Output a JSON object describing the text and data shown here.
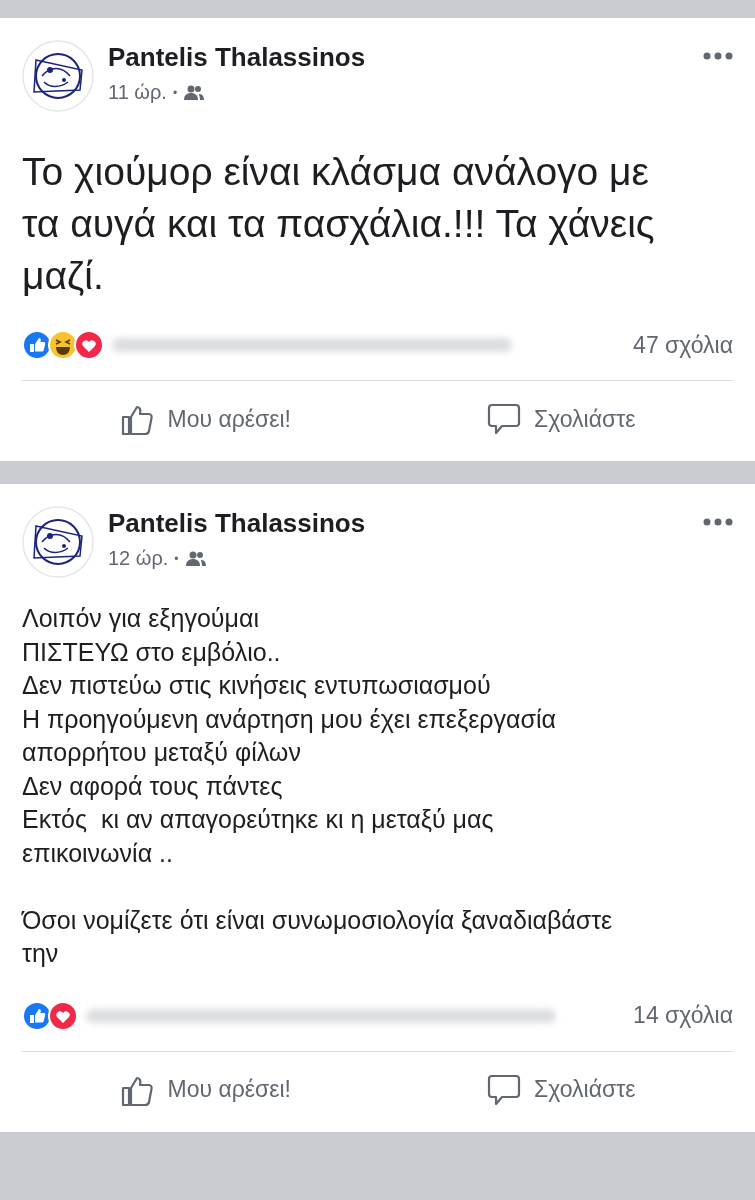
{
  "posts": [
    {
      "author": "Pantelis Thalassinos",
      "time": "11 ώρ.",
      "dot": "•",
      "kind": "large",
      "text": "Το χιούμορ είναι κλάσμα ανάλογο με\nτα αυγά και τα πασχάλια.!!! Τα χάνεις\nμαζί.",
      "reactions": [
        {
          "kind": "like"
        },
        {
          "kind": "haha"
        },
        {
          "kind": "love"
        }
      ],
      "comments": "47 σχόλια",
      "like_label": "Μου αρέσει!",
      "comment_label": "Σχολιάστε"
    },
    {
      "author": "Pantelis Thalassinos",
      "time": "12 ώρ.",
      "dot": "•",
      "kind": "normal",
      "text": "Λοιπόν για εξηγούμαι\nΠΙΣΤΕΥΩ στο εμβόλιο..\nΔεν πιστεύω στις κινήσεις εντυπωσιασμού\nΗ προηγούμενη ανάρτηση μου έχει επεξεργασία\nαπορρήτου μεταξύ φίλων\nΔεν αφορά τους πάντες\nΕκτός  κι αν απαγορεύτηκε κι η μεταξύ μας\nεπικοινωνία ..\n\nΌσοι νομίζετε ότι είναι συνωμοσιολογία ξαναδιαβάστε\nτην",
      "reactions": [
        {
          "kind": "like"
        },
        {
          "kind": "love"
        }
      ],
      "comments": "14 σχόλια",
      "like_label": "Μου αρέσει!",
      "comment_label": "Σχολιάστε"
    }
  ]
}
